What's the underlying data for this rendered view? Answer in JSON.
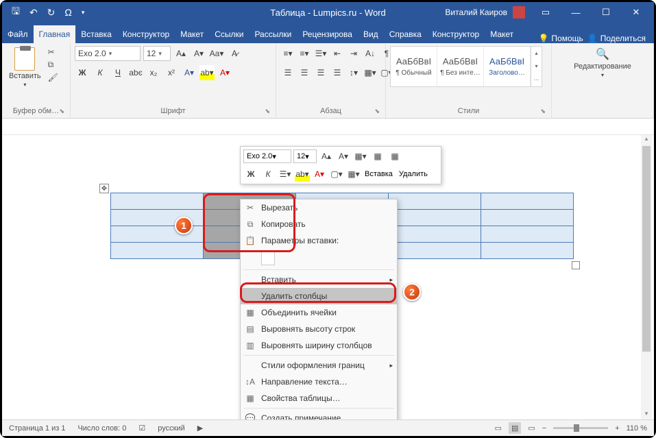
{
  "titlebar": {
    "title": "Таблица - Lumpics.ru  -  Word",
    "user": "Виталий Каиров"
  },
  "tabs": {
    "file": "Файл",
    "home": "Главная",
    "insert": "Вставка",
    "design": "Конструктор",
    "layout": "Макет",
    "references": "Ссылки",
    "mailings": "Рассылки",
    "review": "Рецензирова",
    "view": "Вид",
    "help": "Справка",
    "table_design": "Конструктор",
    "table_layout": "Макет",
    "tell_me": "Помощь",
    "share": "Поделиться"
  },
  "ribbon": {
    "clipboard": {
      "paste": "Вставить",
      "label": "Буфер обм…"
    },
    "font": {
      "name": "Exo 2.0",
      "size": "12",
      "bold": "Ж",
      "italic": "К",
      "underline": "Ч",
      "label": "Шрифт"
    },
    "paragraph": {
      "label": "Абзац"
    },
    "styles": {
      "preview": "АаБбВвІ",
      "s1": "¶ Обычный",
      "s2": "¶ Без инте…",
      "s3": "Заголово…",
      "label": "Стили"
    },
    "editing": {
      "label": "Редактирование"
    }
  },
  "minitoolbar": {
    "font": "Exo 2.0",
    "size": "12",
    "bold": "Ж",
    "italic": "К",
    "insert": "Вставка",
    "delete": "Удалить"
  },
  "context_menu": {
    "cut": "Вырезать",
    "copy": "Копировать",
    "paste_options": "Параметры вставки:",
    "insert_row": "Вставить",
    "delete_columns": "Удалить столбцы",
    "merge_cells": "Объединить ячейки",
    "dist_rows": "Выровнять высоту строк",
    "dist_cols": "Выровнять ширину столбцов",
    "border_styles": "Стили оформления границ",
    "text_direction": "Направление текста…",
    "table_props": "Свойства таблицы…",
    "new_comment": "Создать примечание"
  },
  "statusbar": {
    "page": "Страница  1 из 1",
    "words": "Число слов: 0",
    "lang": "русский",
    "zoom": "110 %"
  },
  "badges": {
    "one": "1",
    "two": "2"
  }
}
